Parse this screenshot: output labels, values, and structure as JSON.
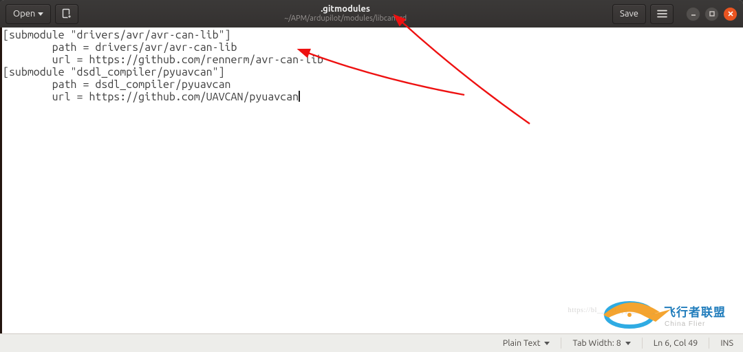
{
  "header": {
    "open_label": "Open",
    "save_label": "Save",
    "title": ".gitmodules",
    "subtitle": "~/APM/ardupilot/modules/libcanard"
  },
  "file_content": {
    "lines": [
      "[submodule \"drivers/avr/avr-can-lib\"]",
      "        path = drivers/avr/avr-can-lib",
      "        url = https://github.com/rennerm/avr-can-lib",
      "[submodule \"dsdl_compiler/pyuavcan\"]",
      "        path = dsdl_compiler/pyuavcan",
      "        url = https://github.com/UAVCAN/pyuavcan"
    ]
  },
  "statusbar": {
    "syntax": "Plain Text",
    "tab_width": "Tab Width: 8",
    "position": "Ln 6, Col 49",
    "mode": "INS"
  },
  "watermark": {
    "brand_cn": "飞行者联盟",
    "brand_en": "China Flier",
    "url_hint": "https://bl__.net/qq_______"
  }
}
